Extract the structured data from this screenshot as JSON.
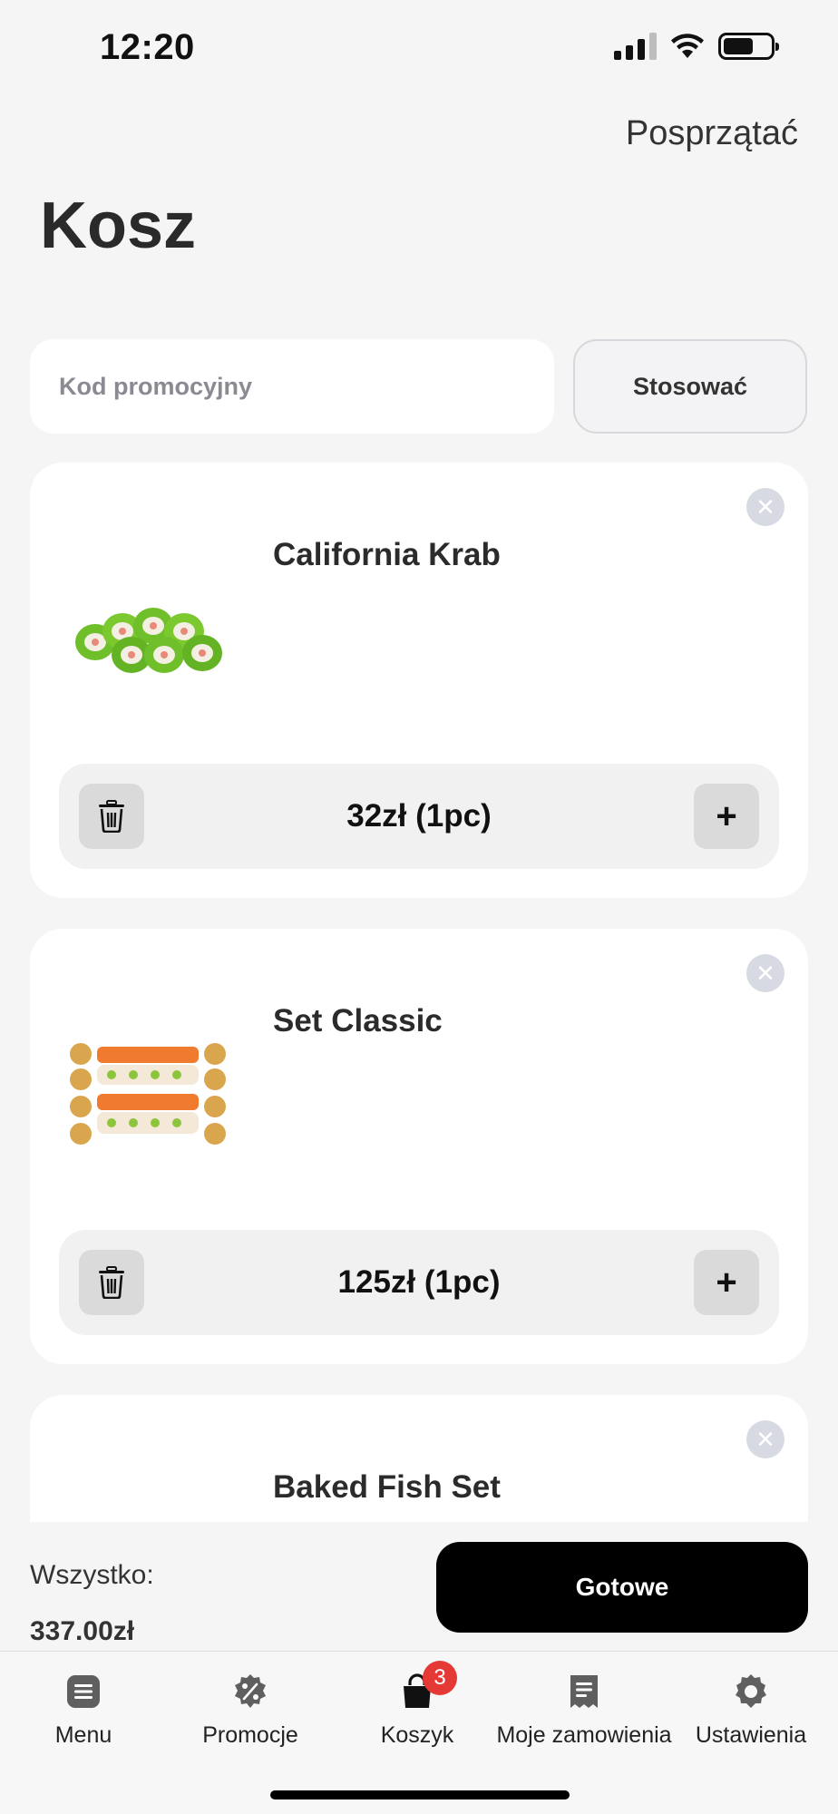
{
  "status_bar": {
    "time": "12:20"
  },
  "header": {
    "clear_label": "Posprzątać",
    "title": "Kosz"
  },
  "promo": {
    "placeholder": "Kod promocyjny",
    "apply_label": "Stosować"
  },
  "cart": {
    "items": [
      {
        "name": "California Krab",
        "price_qty": "32zł (1pc)"
      },
      {
        "name": "Set Classic",
        "price_qty": "125zł (1pc)"
      },
      {
        "name": "Baked Fish Set",
        "price_qty": ""
      }
    ]
  },
  "summary": {
    "total_label": "Wszystko:",
    "total_value": "337.00zł",
    "done_label": "Gotowe"
  },
  "tabs": [
    {
      "label": "Menu",
      "icon": "menu-icon"
    },
    {
      "label": "Promocje",
      "icon": "percent-badge-icon"
    },
    {
      "label": "Koszyk",
      "icon": "shopping-bag-icon",
      "badge": "3"
    },
    {
      "label": "Moje zamowienia",
      "icon": "receipt-icon"
    },
    {
      "label": "Ustawienia",
      "icon": "gear-icon"
    }
  ]
}
